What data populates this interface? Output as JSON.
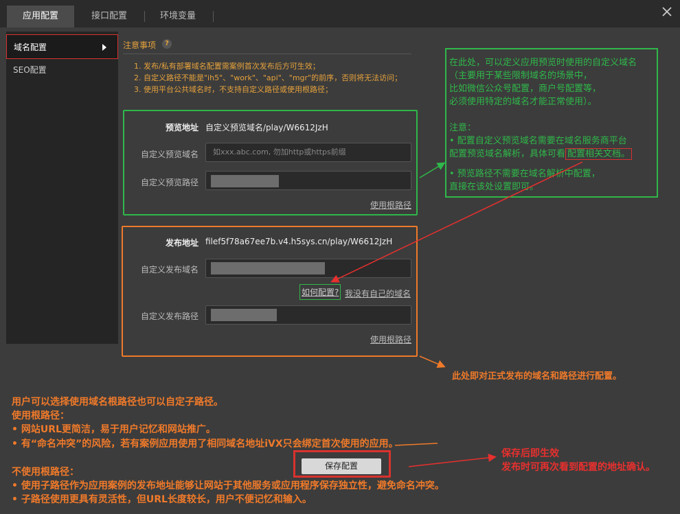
{
  "tabs": [
    "应用配置",
    "接口配置",
    "环境变量"
  ],
  "sidebar": {
    "items": [
      {
        "label": "域名配置"
      },
      {
        "label": "SEO配置"
      }
    ]
  },
  "notice": {
    "title": "注意事项",
    "help": "?",
    "items": [
      "1. 发布/私有部署域名配置需案例首次发布后方可生效；",
      "2. 自定义路径不能是\"ih5\"、\"work\"、\"api\"、\"mgr\"的前序，否则将无法访问；",
      "3. 使用平台公共域名时，不支持自定义路径或使用根路径；"
    ]
  },
  "preview": {
    "address_label": "预览地址",
    "address_value": "自定义预览域名/play/W6612JzH",
    "domain_label": "自定义预览域名",
    "domain_placeholder": "如xxx.abc.com, 勿加http或https前缀",
    "path_label": "自定义预览路径",
    "root_link": "使用根路径"
  },
  "publish": {
    "address_label": "发布地址",
    "address_value": "filef5f78a67ee7b.v4.h5sys.cn/play/W6612JzH",
    "domain_label": "自定义发布域名",
    "how_link": "如何配置?",
    "no_domain_link": "我没有自己的域名",
    "path_label": "自定义发布路径",
    "root_link": "使用根路径"
  },
  "save_button": "保存配置",
  "annotations": {
    "green_note": [
      "在此处，可以定义应用预览时使用的自定义域名",
      "（主要用于某些限制域名的场景中，",
      "比如微信公众号配置，商户号配置等，",
      "必须使用特定的域名才能正常使用）。",
      "",
      "注意：",
      "  •  配置自定义预览域名需要在域名服务商平台",
      "配置预览域名解析，具体可看",
      "",
      "  •  预览路径不需要在域名解析中配置，",
      "直接在该处设置即可。"
    ],
    "green_doc_link": "配置相关文档。",
    "publish_note": "此处即对正式发布的域名和路径进行配置。",
    "root_path_notes": [
      "用户可以选择使用域名根路径也可以自定子路径。",
      "使用根路径：",
      "  •  网站URL更简洁，易于用户记忆和网站推广。",
      "  •  有“命名冲突”的风险，若有案例应用使用了相同域名地址iVX只会绑定首次使用的应用。",
      "",
      "不使用根路径：",
      "  •  使用子路径作为应用案例的发布地址能够让网站于其他服务或应用程序保存独立性，避免命名冲突。",
      "  •  子路径使用更具有灵活性，但URL长度较长，用户不便记忆和输入。"
    ],
    "save_note": [
      "保存后即生效",
      "发布时可再次看到配置的地址确认。"
    ]
  }
}
